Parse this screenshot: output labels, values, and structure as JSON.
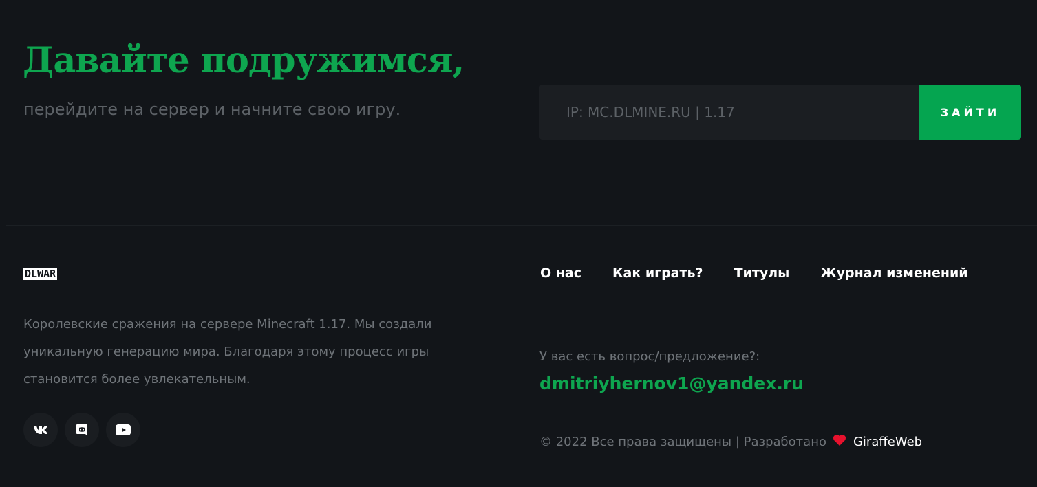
{
  "hero": {
    "title": "Давайте подружимся,",
    "subtitle": "перейдите на сервер и начните свою игру.",
    "ip_text": "IP: MC.DLMINE.RU | 1.17",
    "join_button": "ЗАЙТИ"
  },
  "footer": {
    "logo": "DLWAR",
    "description": "Королевские сражения на сервере Minecraft 1.17. Мы создали уникальную генерацию мира. Благодаря этому процесс игры становится более увлекательным.",
    "social": [
      {
        "icon": "vk-icon"
      },
      {
        "icon": "discord-icon"
      },
      {
        "icon": "youtube-icon"
      }
    ],
    "nav": [
      {
        "label": "О нас"
      },
      {
        "label": "Как играть?"
      },
      {
        "label": "Титулы"
      },
      {
        "label": "Журнал изменений"
      }
    ],
    "question": "У вас есть вопрос/предложение?:",
    "email": "dmitriyhernov1@yandex.ru",
    "copyright": "© 2022 Все права защищены | Разработано",
    "developer": "GiraffeWeb"
  },
  "colors": {
    "background": "#121519",
    "accent": "#05a550",
    "heart": "#e8112d"
  }
}
